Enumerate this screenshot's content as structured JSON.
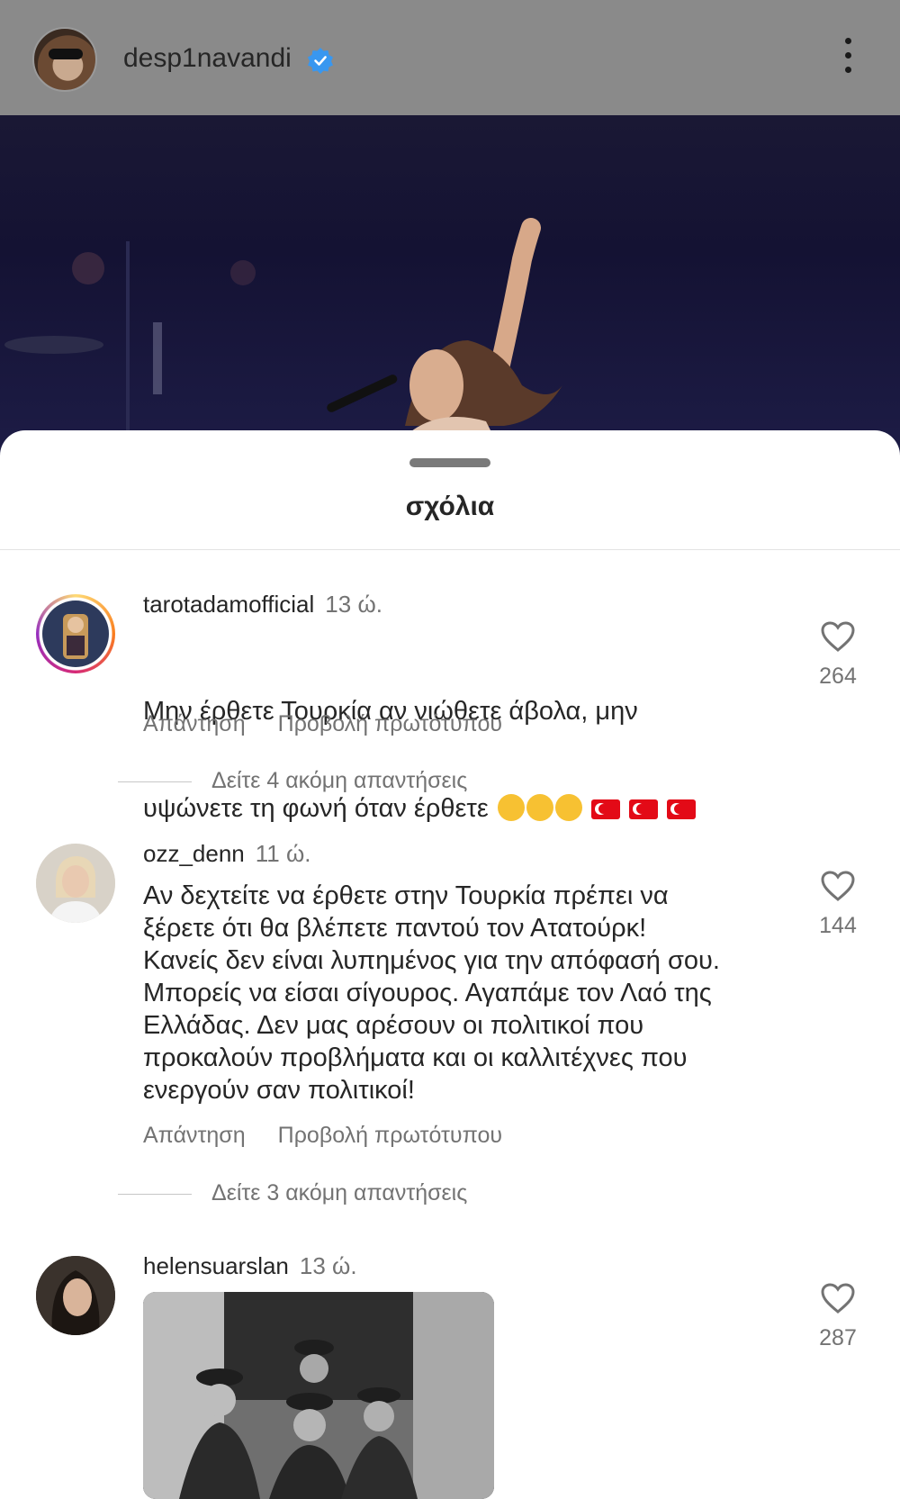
{
  "header": {
    "username": "desp1navandi",
    "verified": true,
    "more_icon": "more-vertical-icon"
  },
  "sheet": {
    "title": "σχόλια"
  },
  "comments": [
    {
      "username": "tarotadamofficial",
      "time": "13 ώ.",
      "text_line1": "Μην έρθετε Τουρκία αν νιώθετε άβολα, μην",
      "text_line2": "υψώνετε τη φωνή όταν έρθετε",
      "likes": "264",
      "reply_label": "Απάντηση",
      "translate_label": "Προβολή πρωτότυπου",
      "more_replies": "Δείτε 4 ακόμη απαντήσεις"
    },
    {
      "username": "ozz_denn",
      "time": "11 ώ.",
      "text": "Αν δεχτείτε να έρθετε στην Τουρκία πρέπει να\nξέρετε ότι θα βλέπετε παντού τον Ατατούρκ!\nΚανείς δεν είναι λυπημένος για την απόφασή σου.\nΜπορείς να είσαι σίγουρος. Αγαπάμε τον Λαό της\nΕλλάδας. Δεν μας αρέσουν οι πολιτικοί που\nπροκαλούν προβλήματα και οι καλλιτέχνες που\nενεργούν σαν πολιτικοί!",
      "likes": "144",
      "reply_label": "Απάντηση",
      "translate_label": "Προβολή πρωτότυπου",
      "more_replies": "Δείτε 3 ακόμη απαντήσεις"
    },
    {
      "username": "helensuarslan",
      "time": "13 ώ.",
      "likes": "287"
    }
  ],
  "colors": {
    "header_bg": "#8a8a8a",
    "verified_blue": "#3897f0",
    "text": "#262626",
    "secondary": "#737373"
  }
}
